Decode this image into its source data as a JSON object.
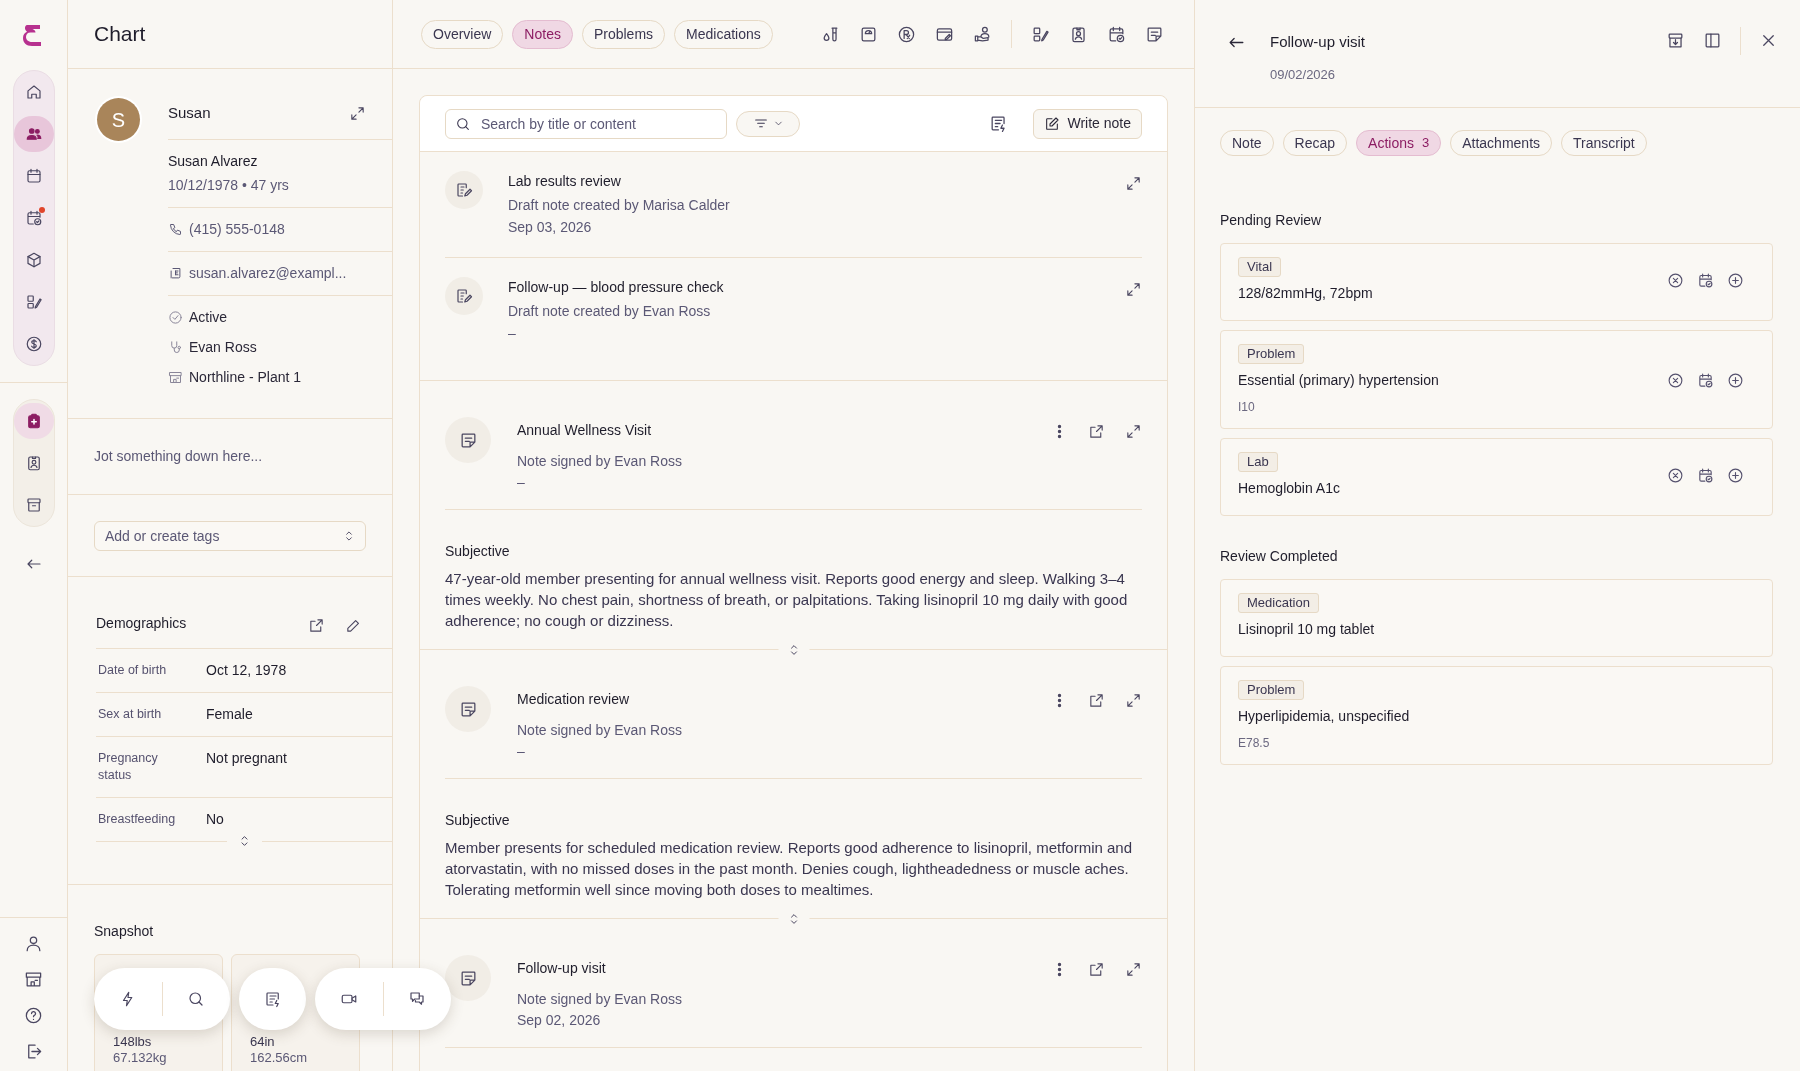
{
  "nav_rail": {
    "primary": [
      {
        "selected": false,
        "notification": false
      },
      {
        "selected": true,
        "notification": false
      },
      {
        "selected": false,
        "notification": false
      },
      {
        "selected": false,
        "notification": true
      },
      {
        "selected": false,
        "notification": false
      },
      {
        "selected": false,
        "notification": false
      },
      {
        "selected": false,
        "notification": false
      }
    ],
    "secondary": [
      {
        "selected": true
      },
      {
        "selected": false
      },
      {
        "selected": false
      }
    ]
  },
  "page_title": "Chart",
  "patient": {
    "avatar_initial": "S",
    "first_name": "Susan",
    "full_name": "Susan Alvarez",
    "dob_age": "10/12/1978 • 47 yrs",
    "phone": "(415) 555-0148",
    "email": "susan.alvarez@exampl...",
    "status": "Active",
    "provider": "Evan Ross",
    "site": "Northline - Plant 1"
  },
  "jot": {
    "placeholder": "Jot something down here..."
  },
  "tags": {
    "placeholder": "Add or create tags"
  },
  "demographics": {
    "title": "Demographics",
    "rows": [
      {
        "label": "Date of birth",
        "value": "Oct 12, 1978"
      },
      {
        "label": "Sex at birth",
        "value": "Female"
      },
      {
        "label": "Pregnancy status",
        "value": "Not pregnant"
      },
      {
        "label": "Breastfeeding",
        "value": "No"
      }
    ]
  },
  "snapshot": {
    "title": "Snapshot",
    "cards": [
      {
        "primary": "148lbs",
        "secondary": "67.132kg"
      },
      {
        "primary": "64in",
        "secondary": "162.56cm"
      }
    ]
  },
  "tabs": [
    {
      "label": "Overview",
      "selected": false
    },
    {
      "label": "Notes",
      "selected": true
    },
    {
      "label": "Problems",
      "selected": false
    },
    {
      "label": "Medications",
      "selected": false
    }
  ],
  "notes_toolbar": {
    "search": {
      "placeholder": "Search by title or content"
    },
    "write_button": "Write note"
  },
  "notes": [
    {
      "kind": "draft",
      "title": "Lab results review",
      "subtitle": "Draft note created by Marisa Calder",
      "date": "Sep 03, 2026"
    },
    {
      "kind": "draft",
      "title": "Follow-up — blood pressure check",
      "subtitle": "Draft note created by Evan Ross",
      "date": "–"
    },
    {
      "kind": "signed",
      "title": "Annual Wellness Visit",
      "subtitle": "Note signed by Evan Ross",
      "date": "–",
      "section_title": "Subjective",
      "section_text": "47-year-old member presenting for annual wellness visit. Reports good energy and sleep. Walking 3–4 times weekly. No chest pain, shortness of breath, or palpitations. Taking lisinopril 10 mg daily with good adherence; no cough or dizziness."
    },
    {
      "kind": "signed",
      "title": "Medication review",
      "subtitle": "Note signed by Evan Ross",
      "date": "–",
      "section_title": "Subjective",
      "section_text": "Member presents for scheduled medication review. Reports good adherence to lisinopril, metformin and atorvastatin, with no missed doses in the past month. Denies cough, lightheadedness or muscle aches. Tolerating metformin well since moving both doses to mealtimes."
    },
    {
      "kind": "signed",
      "title": "Follow-up visit",
      "subtitle": "Note signed by Evan Ross",
      "date": "Sep 02, 2026"
    }
  ],
  "detail": {
    "title": "Follow-up visit",
    "date": "09/02/2026",
    "tabs": [
      {
        "label": "Note",
        "selected": false
      },
      {
        "label": "Recap",
        "selected": false
      },
      {
        "label": "Actions",
        "count": "3",
        "selected": true
      },
      {
        "label": "Attachments",
        "selected": false
      },
      {
        "label": "Transcript",
        "selected": false
      }
    ],
    "sections": [
      {
        "title": "Pending Review",
        "kind": "pending",
        "items": [
          {
            "tag": "Vital",
            "title": "128/82mmHg, 72bpm"
          },
          {
            "tag": "Problem",
            "title": "Essential (primary) hypertension",
            "code": "I10"
          },
          {
            "tag": "Lab",
            "title": "Hemoglobin A1c"
          }
        ]
      },
      {
        "title": "Review Completed",
        "kind": "completed",
        "items": [
          {
            "tag": "Medication",
            "title": "Lisinopril 10 mg tablet"
          },
          {
            "tag": "Problem",
            "title": "Hyperlipidemia, unspecified",
            "code": "E78.5"
          }
        ]
      }
    ]
  }
}
